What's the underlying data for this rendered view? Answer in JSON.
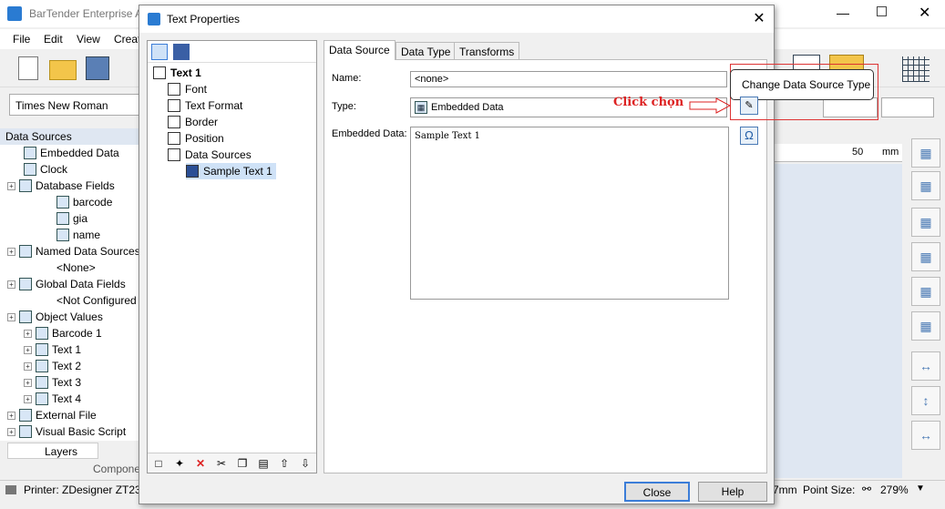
{
  "app": {
    "title": "BarTender Enterprise Au",
    "menus": [
      "File",
      "Edit",
      "View",
      "Creat"
    ],
    "font_name": "Times New Roman"
  },
  "data_sources_panel": {
    "header": "Data Sources",
    "items": [
      {
        "label": "Embedded Data",
        "level": 1
      },
      {
        "label": "Clock",
        "level": 1
      },
      {
        "label": "Database Fields",
        "level": 0
      },
      {
        "label": "barcode",
        "level": 2
      },
      {
        "label": "gia",
        "level": 2
      },
      {
        "label": "name",
        "level": 2
      },
      {
        "label": "Named Data Sources",
        "level": 0
      },
      {
        "label": "<None>",
        "level": 2
      },
      {
        "label": "Global Data Fields",
        "level": 0
      },
      {
        "label": "<Not Configured",
        "level": 2
      },
      {
        "label": "Object Values",
        "level": 0
      },
      {
        "label": "Barcode 1",
        "level": 1
      },
      {
        "label": "Text 1",
        "level": 1
      },
      {
        "label": "Text 2",
        "level": 1
      },
      {
        "label": "Text 3",
        "level": 1
      },
      {
        "label": "Text 4",
        "level": 1
      },
      {
        "label": "External File",
        "level": 0
      },
      {
        "label": "Visual Basic Script",
        "level": 0
      }
    ],
    "tabs": [
      "Layers",
      "Compone"
    ]
  },
  "status_bar": {
    "printer": "Printer: ZDesigner ZT230",
    "units_fragment": "7mm",
    "point_size_label": "Point Size:",
    "zoom": "279%"
  },
  "ruler": {
    "tick_label": "50",
    "unit": "mm"
  },
  "dialog": {
    "title": "Text Properties",
    "nav": [
      {
        "label": "Text 1",
        "level": 0,
        "bold": true
      },
      {
        "label": "Font",
        "level": 1
      },
      {
        "label": "Text Format",
        "level": 1
      },
      {
        "label": "Border",
        "level": 1
      },
      {
        "label": "Position",
        "level": 1
      },
      {
        "label": "Data Sources",
        "level": 1
      },
      {
        "label": "Sample Text 1",
        "level": 2
      }
    ],
    "tabs": [
      "Data Source",
      "Data Type",
      "Transforms"
    ],
    "active_tab": "Data Source",
    "fields": {
      "name_label": "Name:",
      "name_value": "<none>",
      "type_label": "Type:",
      "type_value": "Embedded Data",
      "embedded_label": "Embedded Data:",
      "embedded_value": "Sample Text 1"
    },
    "annotation": "Click chọn",
    "tooltip": "Change Data Source Type",
    "buttons": {
      "close": "Close",
      "help": "Help"
    },
    "omega": "Ω"
  },
  "colors": {
    "accent": "#3b7dd8",
    "annotation": "#d22222"
  }
}
